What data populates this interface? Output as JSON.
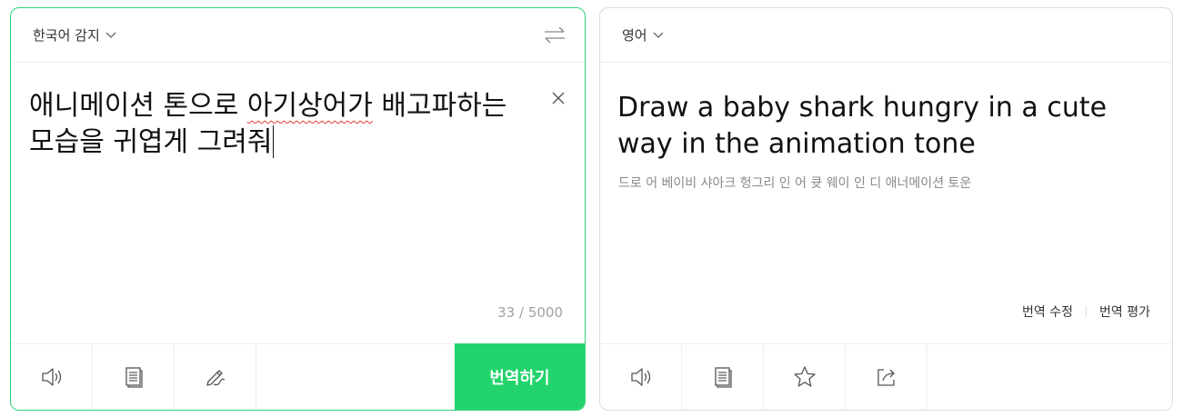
{
  "source": {
    "language_label": "한국어 감지",
    "text_part1": "애니메이션 톤으로 ",
    "text_misspelled": "아기상어가",
    "text_part2": " 배고파하는 모습을 귀엽게 그려줘",
    "char_count": "33 / 5000",
    "translate_button": "번역하기",
    "toolbar_icons": [
      "speaker-icon",
      "document-icon",
      "pen-icon"
    ]
  },
  "target": {
    "language_label": "영어",
    "translation": "Draw a baby shark hungry in a cute way in the animation tone",
    "pronunciation": "드로 어 베이비 샤아크 헝그리 인 어 큣 웨이 인 디 애너메이션 토운",
    "edit_translation": "번역 수정",
    "rate_translation": "번역 평가",
    "toolbar_icons": [
      "speaker-icon",
      "document-icon",
      "star-icon",
      "share-icon"
    ]
  },
  "colors": {
    "accent": "#22d46b",
    "source_border": "#2fd37a",
    "spell_error": "#e53935"
  }
}
